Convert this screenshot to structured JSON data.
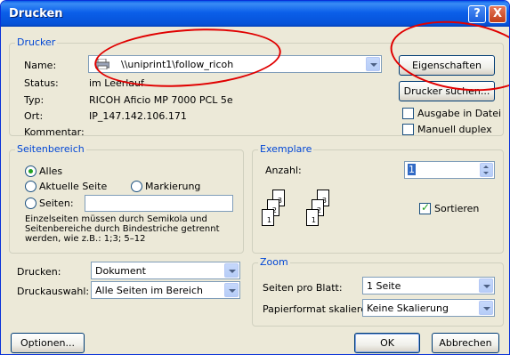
{
  "window": {
    "title": "Drucken",
    "help": "?",
    "close": "X"
  },
  "printer": {
    "group_label": "Drucker",
    "name_label": "Name:",
    "name_value": "\\\\uniprint1\\follow_ricoh",
    "status_label": "Status:",
    "status_value": "im Leerlauf",
    "type_label": "Typ:",
    "type_value": "RICOH Aficio MP 7000 PCL 5e",
    "location_label": "Ort:",
    "location_value": "IP_147.142.106.171",
    "comment_label": "Kommentar:",
    "properties_button": "Eigenschaften",
    "find_button": "Drucker suchen...",
    "print_to_file": "Ausgabe in Datei",
    "manual_duplex": "Manuell duplex"
  },
  "range": {
    "group_label": "Seitenbereich",
    "all": "Alles",
    "current": "Aktuelle Seite",
    "selection": "Markierung",
    "pages": "Seiten:",
    "hint": "Einzelseiten müssen durch Semikola und Seitenbereiche durch Bindestriche getrennt werden, wie z.B.: 1;3; 5–12"
  },
  "copies": {
    "group_label": "Exemplare",
    "count_label": "Anzahl:",
    "count_value": "1",
    "collate": "Sortieren",
    "page_numbers": [
      "1",
      "2",
      "3"
    ]
  },
  "print_what": {
    "label": "Drucken:",
    "value": "Dokument"
  },
  "print_selection": {
    "label": "Druckauswahl:",
    "value": "Alle Seiten im Bereich"
  },
  "zoom": {
    "group_label": "Zoom",
    "pages_per_sheet_label": "Seiten pro Blatt:",
    "pages_per_sheet_value": "1 Seite",
    "scale_label": "Papierformat skalieren:",
    "scale_value": "Keine Skalierung"
  },
  "buttons": {
    "options": "Optionen...",
    "ok": "OK",
    "cancel": "Abbrechen"
  },
  "colors": {
    "annotation": "#e00000",
    "title_bar": "#0552d8",
    "dialog": "#ece9d8"
  }
}
